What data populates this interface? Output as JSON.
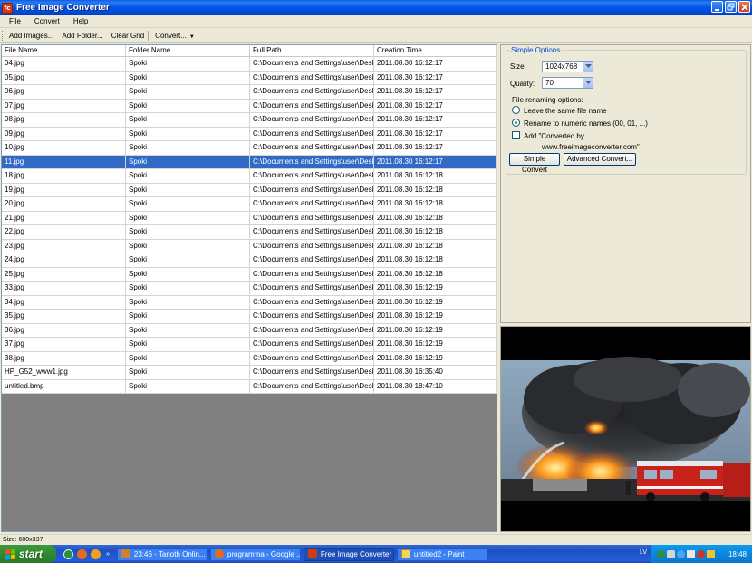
{
  "window": {
    "title": "Free Image Converter",
    "icon_text": "fc"
  },
  "menu": [
    "File",
    "Convert",
    "Help"
  ],
  "toolbar": {
    "add_images": "Add Images...",
    "add_folder": "Add Folder...",
    "clear_grid": "Clear Grid",
    "convert": "Convert..."
  },
  "grid": {
    "columns": [
      "File Name",
      "Folder Name",
      "Full Path",
      "Creation Time"
    ],
    "selected_index": 7,
    "rows": [
      [
        "04.jpg",
        "Spoki",
        "C:\\Documents and Settings\\user\\Deskt...",
        "2011.08.30 16:12:17"
      ],
      [
        "05.jpg",
        "Spoki",
        "C:\\Documents and Settings\\user\\Deskt...",
        "2011.08.30 16:12:17"
      ],
      [
        "06.jpg",
        "Spoki",
        "C:\\Documents and Settings\\user\\Deskt...",
        "2011.08.30 16:12:17"
      ],
      [
        "07.jpg",
        "Spoki",
        "C:\\Documents and Settings\\user\\Deskt...",
        "2011.08.30 16:12:17"
      ],
      [
        "08.jpg",
        "Spoki",
        "C:\\Documents and Settings\\user\\Deskt...",
        "2011.08.30 16:12:17"
      ],
      [
        "09.jpg",
        "Spoki",
        "C:\\Documents and Settings\\user\\Deskt...",
        "2011.08.30 16:12:17"
      ],
      [
        "10.jpg",
        "Spoki",
        "C:\\Documents and Settings\\user\\Deskt...",
        "2011.08.30 16:12:17"
      ],
      [
        "11.jpg",
        "Spoki",
        "C:\\Documents and Settings\\user\\Deskt...",
        "2011.08.30 16:12:17"
      ],
      [
        "18.jpg",
        "Spoki",
        "C:\\Documents and Settings\\user\\Deskt...",
        "2011.08.30 16:12:18"
      ],
      [
        "19.jpg",
        "Spoki",
        "C:\\Documents and Settings\\user\\Deskt...",
        "2011.08.30 16:12:18"
      ],
      [
        "20.jpg",
        "Spoki",
        "C:\\Documents and Settings\\user\\Deskt...",
        "2011.08.30 16:12:18"
      ],
      [
        "21.jpg",
        "Spoki",
        "C:\\Documents and Settings\\user\\Deskt...",
        "2011.08.30 16:12:18"
      ],
      [
        "22.jpg",
        "Spoki",
        "C:\\Documents and Settings\\user\\Deskt...",
        "2011.08.30 16:12:18"
      ],
      [
        "23.jpg",
        "Spoki",
        "C:\\Documents and Settings\\user\\Deskt...",
        "2011.08.30 16:12:18"
      ],
      [
        "24.jpg",
        "Spoki",
        "C:\\Documents and Settings\\user\\Deskt...",
        "2011.08.30 16:12:18"
      ],
      [
        "25.jpg",
        "Spoki",
        "C:\\Documents and Settings\\user\\Deskt...",
        "2011.08.30 16:12:18"
      ],
      [
        "33.jpg",
        "Spoki",
        "C:\\Documents and Settings\\user\\Deskt...",
        "2011.08.30 16:12:19"
      ],
      [
        "34.jpg",
        "Spoki",
        "C:\\Documents and Settings\\user\\Deskt...",
        "2011.08.30 16:12:19"
      ],
      [
        "35.jpg",
        "Spoki",
        "C:\\Documents and Settings\\user\\Deskt...",
        "2011.08.30 16:12:19"
      ],
      [
        "36.jpg",
        "Spoki",
        "C:\\Documents and Settings\\user\\Deskt...",
        "2011.08.30 16:12:19"
      ],
      [
        "37.jpg",
        "Spoki",
        "C:\\Documents and Settings\\user\\Deskt...",
        "2011.08.30 16:12:19"
      ],
      [
        "38.jpg",
        "Spoki",
        "C:\\Documents and Settings\\user\\Deskt...",
        "2011.08.30 16:12:19"
      ],
      [
        "HP_G52_www1.jpg",
        "Spoki",
        "C:\\Documents and Settings\\user\\Deskt...",
        "2011.08.30 16:35:40"
      ],
      [
        "untitled.bmp",
        "Spoki",
        "C:\\Documents and Settings\\user\\Deskt...",
        "2011.08.30 18:47:10"
      ]
    ]
  },
  "options": {
    "group_title": "Simple Options",
    "size_label": "Size:",
    "size_value": "1024x768",
    "quality_label": "Quality:",
    "quality_value": "70",
    "renaming_label": "File renaming options:",
    "radio_same": "Leave the same file name",
    "radio_numeric": "Rename to numeric names (00, 01, ...)",
    "radio_selected": "numeric",
    "add_converted_line1": "Add \"Converted by",
    "add_converted_line2": "www.freeimageconverter.com\"",
    "add_converted_checked": false,
    "simple_convert": "Simple Convert",
    "advanced_convert": "Advanced Convert..."
  },
  "status": {
    "size_text": "Size: 600x337"
  },
  "taskbar": {
    "start_label": "start",
    "tasks": [
      {
        "label": "23:46 - Tanoth Onlin...",
        "active": false
      },
      {
        "label": "programma - Google ...",
        "active": false
      },
      {
        "label": "Free Image Converter",
        "active": true
      },
      {
        "label": "untitled2 - Paint",
        "active": false
      }
    ],
    "language": "LV",
    "clock": "18:48"
  },
  "colors": {
    "selection": "#316ac5",
    "title_bar": "#0053e6",
    "start_green": "#2f8b2f"
  }
}
